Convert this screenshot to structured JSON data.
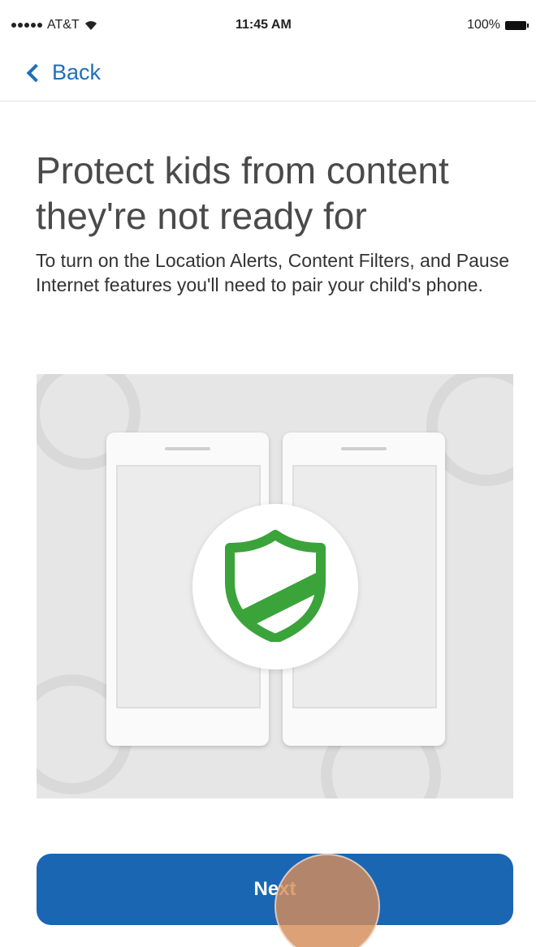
{
  "status_bar": {
    "carrier": "AT&T",
    "time": "11:45 AM",
    "battery": "100%"
  },
  "nav": {
    "back_label": "Back"
  },
  "content": {
    "title": "Protect kids from content they're not ready for",
    "description": "To turn on the Location Alerts, Content Filters, and Pause Internet features you'll need to pair your child's phone."
  },
  "illustration": {
    "icon": "shield-icon",
    "shield_color": "#3aa33a"
  },
  "actions": {
    "next_label": "Next"
  },
  "colors": {
    "accent_blue": "#1a66b3",
    "link_blue": "#1f6fb8"
  }
}
